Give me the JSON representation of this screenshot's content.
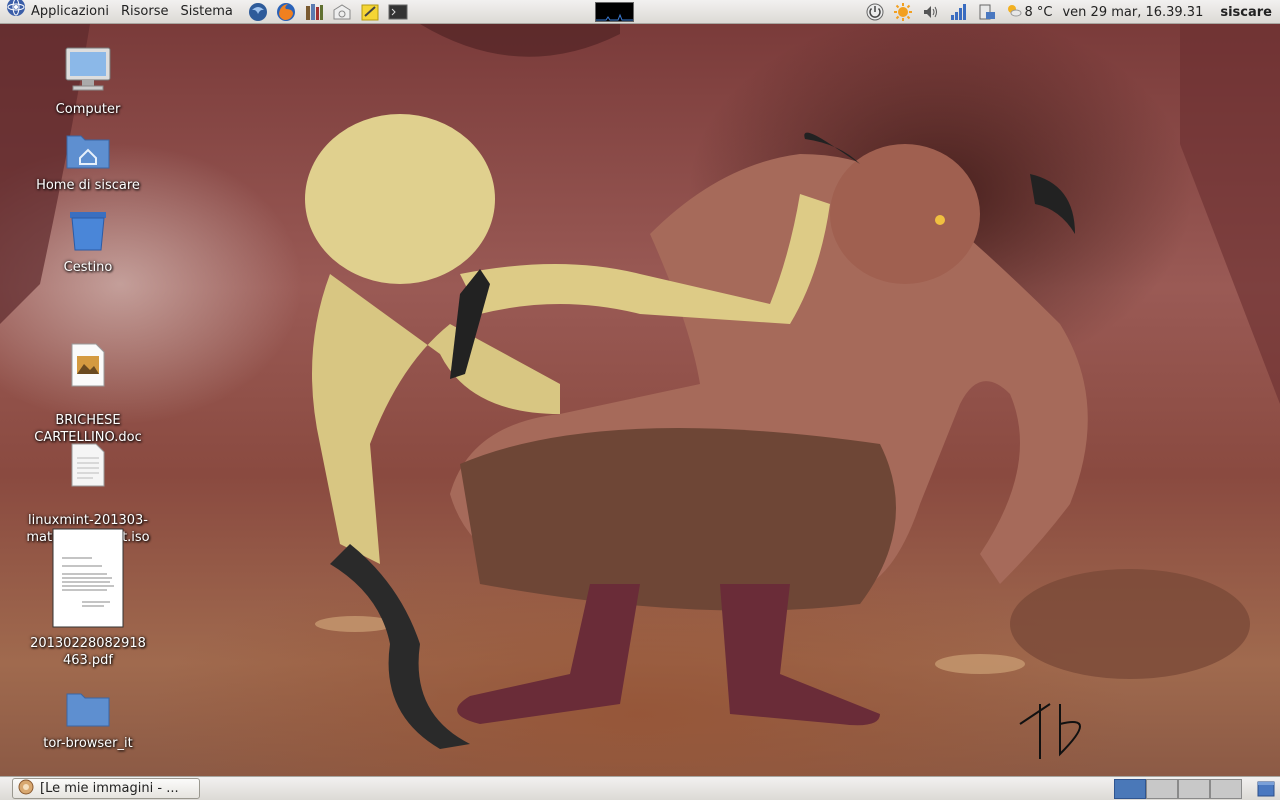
{
  "top_panel": {
    "menus": [
      "Applicazioni",
      "Risorse",
      "Sistema"
    ],
    "launchers": [
      {
        "name": "thunderbird-icon"
      },
      {
        "name": "firefox-icon"
      },
      {
        "name": "library-icon"
      },
      {
        "name": "mail-stamp-icon"
      },
      {
        "name": "notes-icon"
      },
      {
        "name": "terminal-icon"
      }
    ],
    "tray": {
      "power_icon": "power-icon",
      "weather_temp": "8 °C",
      "datetime": "ven 29 mar, 16.39.31",
      "user": "siscare"
    }
  },
  "desktop": {
    "icons": [
      {
        "label": "Computer"
      },
      {
        "label": "Home di siscare"
      },
      {
        "label": "Cestino"
      },
      {
        "label": "BRICHESE\nCARTELLINO.doc"
      },
      {
        "label": "linuxmint-201303-\nmate-dvd-32bit.iso"
      },
      {
        "label": "20130228082918463.pdf"
      },
      {
        "label": "tor-browser_it"
      }
    ]
  },
  "bottom_panel": {
    "task_label": "[Le mie immagini - ...",
    "workspaces": 4,
    "active_workspace": 1
  },
  "colors": {
    "panel": "#e6e4df",
    "workspace_active": "#4a78b8"
  }
}
